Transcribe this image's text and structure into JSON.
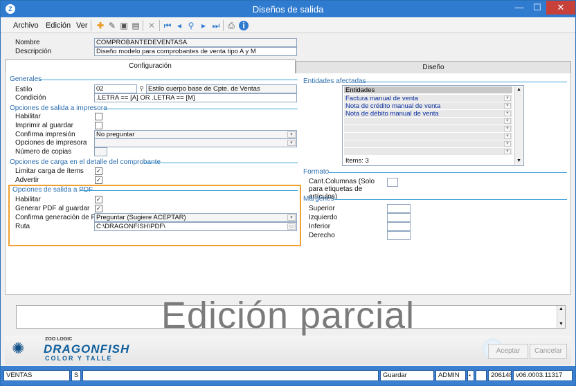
{
  "window": {
    "title": "Diseños de salida",
    "app_icon": "Z",
    "minimize": "—",
    "maximize": "☐",
    "close": "✕"
  },
  "menu": {
    "archivo": "Archivo",
    "edicion": "Edición",
    "ver": "Ver"
  },
  "toolbar_icons": [
    "new-icon",
    "edit-icon",
    "save-icon",
    "save-as-icon",
    "delete-icon",
    "first-icon",
    "prev-icon",
    "next-icon",
    "last-icon",
    "search-icon",
    "preview-icon",
    "info-icon"
  ],
  "header": {
    "nombre_label": "Nombre",
    "nombre_value": "COMPROBANTEDEVENTASA",
    "descripcion_label": "Descripción",
    "descripcion_value": "Diseño modelo para comprobantes de venta tipo A y M"
  },
  "tabs": {
    "configuracion": "Configuración",
    "diseno": "Diseño"
  },
  "generales": {
    "title": "Generales",
    "estilo_label": "Estilo",
    "estilo_value": "02",
    "estilo_desc": "Estilo cuerpo base de Cpte. de Ventas",
    "condicion_label": "Condición",
    "condicion_value": ".LETRA == [A] OR .LETRA == [M]"
  },
  "impresora": {
    "title": "Opciones de salida a impresora",
    "habilitar": "Habilitar",
    "imprimir": "Imprimir al guardar",
    "confirma": "Confirma impresión",
    "confirma_value": "No preguntar",
    "opciones": "Opciones de impresora",
    "copias": "Número de copias"
  },
  "carga": {
    "title": "Opciones de carga en el detalle del comprobante",
    "limitar": "Limitar carga de ítems",
    "advertir": "Advertir"
  },
  "pdf": {
    "title": "Opciones de salida a PDF",
    "habilitar": "Habilitar",
    "generar": "Generar PDF al guardar",
    "confirma": "Confirma generación de PDF",
    "confirma_value": "Preguntar (Sugiere ACEPTAR)",
    "ruta": "Ruta",
    "ruta_value": "C:\\DRAGONFISH\\PDF\\"
  },
  "entidades": {
    "title": "Entidades afectadas",
    "header": "Entidades",
    "items": [
      "Factura manual de venta",
      "Nota de crédito manual de venta",
      "Nota de débito manual de venta"
    ],
    "count": "Items: 3"
  },
  "formato": {
    "title": "Formato",
    "columnas": "Cant.Columnas (Solo para etiquetas de artículos)"
  },
  "margenes": {
    "title": "Márgenes",
    "superior": "Superior",
    "izquierdo": "Izquierdo",
    "inferior": "Inferior",
    "derecho": "Derecho"
  },
  "watermark": "Edición parcial",
  "logo": {
    "brand_small": "ZOO LOGIC",
    "brand": "DRAGONFISH",
    "tagline": "COLOR Y TALLE"
  },
  "buttons": {
    "aceptar": "Aceptar",
    "cancelar": "Cancelar"
  },
  "statusbar": {
    "module": "VENTAS",
    "s": "S",
    "action": "Guardar",
    "user": "ADMIN",
    "build": "206148",
    "version": "v06.0003.11317"
  },
  "colors": {
    "titlebar": "#2f7bd0",
    "accent": "#3aa0d8",
    "highlight": "#f0a030",
    "section_text": "#2e6fb0"
  }
}
